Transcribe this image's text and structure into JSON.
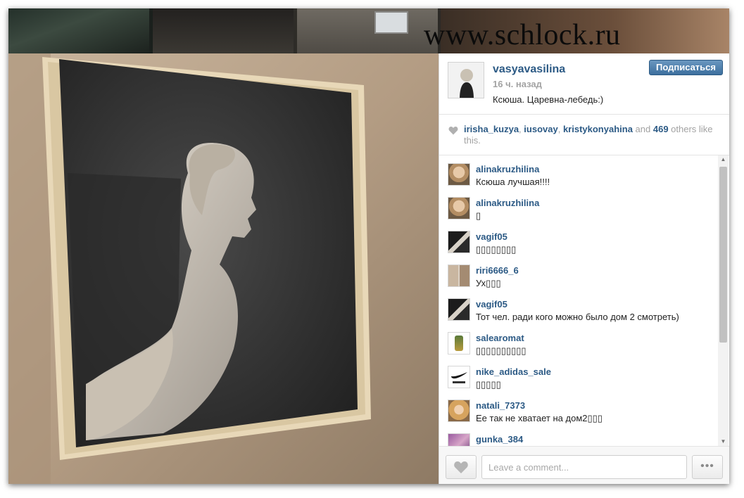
{
  "watermark": "www.schlock.ru",
  "post": {
    "owner": "vasyavasilina",
    "time_ago": "16 ч. назад",
    "caption": "Ксюша. Царевна-лебедь:)",
    "follow_label": "Подписаться"
  },
  "likes": {
    "users": [
      "irisha_kuzya",
      "iusovay",
      "kristykonyahina"
    ],
    "separator": ", ",
    "and_text": " and ",
    "count": "469",
    "suffix": " others like this."
  },
  "comments": [
    {
      "user": "alinakruzhilina",
      "text": "Ксюша лучшая!!!!"
    },
    {
      "user": "alinakruzhilina",
      "text": "▯"
    },
    {
      "user": "vagif05",
      "text": "▯▯▯▯▯▯▯▯"
    },
    {
      "user": "riri6666_6",
      "text": "Ух▯▯▯"
    },
    {
      "user": "vagif05",
      "text": "Тот чел. ради кого можно было дом 2 смотреть)"
    },
    {
      "user": "salearomat",
      "text": "▯▯▯▯▯▯▯▯▯▯"
    },
    {
      "user": "nike_adidas_sale",
      "text": "▯▯▯▯▯"
    },
    {
      "user": "natali_7373",
      "text": "Ее так не хватает на дом2▯▯▯"
    },
    {
      "user": "gunka_384",
      "text": ""
    }
  ],
  "comment_box": {
    "placeholder": "Leave a comment..."
  },
  "more_label": "•••",
  "colors": {
    "link": "#2c5a85",
    "button": "#3c6f9e",
    "muted": "#a3a3a3"
  },
  "icons": [
    "heart-icon",
    "ellipsis-icon",
    "scroll-up-icon",
    "scroll-down-icon"
  ]
}
